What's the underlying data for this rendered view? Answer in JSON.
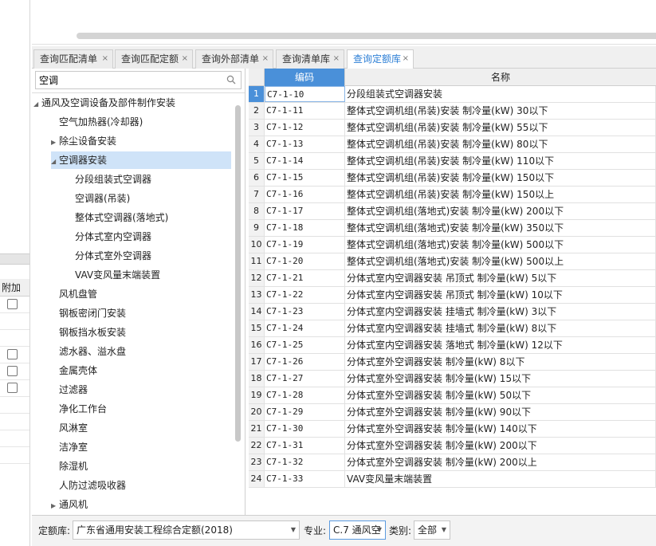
{
  "left_panel": {
    "header": "附加",
    "checkbox_rows": [
      true,
      false,
      false,
      true,
      true,
      true,
      false,
      false,
      false,
      false
    ]
  },
  "tabs": [
    {
      "label": "查询匹配清单",
      "close": "×"
    },
    {
      "label": "查询匹配定额",
      "close": "×"
    },
    {
      "label": "查询外部清单",
      "close": "×"
    },
    {
      "label": "查询清单库",
      "close": "×"
    },
    {
      "label": "查询定额库",
      "close": "×"
    }
  ],
  "search": {
    "value": "空调"
  },
  "tree": [
    {
      "label": "通风及空调设备及部件制作安装",
      "arrow": "◢",
      "level": 0
    },
    {
      "label": "空气加热器(冷却器)",
      "arrow": "",
      "level": 1
    },
    {
      "label": "除尘设备安装",
      "arrow": "▶",
      "level": 1
    },
    {
      "label": "空调器安装",
      "arrow": "◢",
      "level": 1
    },
    {
      "label": "分段组装式空调器",
      "arrow": "",
      "level": 2
    },
    {
      "label": "空调器(吊装)",
      "arrow": "",
      "level": 2
    },
    {
      "label": "整体式空调器(落地式)",
      "arrow": "",
      "level": 2
    },
    {
      "label": "分体式室内空调器",
      "arrow": "",
      "level": 2
    },
    {
      "label": "分体式室外空调器",
      "arrow": "",
      "level": 2
    },
    {
      "label": "VAV变风量末端装置",
      "arrow": "",
      "level": 2
    },
    {
      "label": "风机盘管",
      "arrow": "",
      "level": 1
    },
    {
      "label": "钢板密闭门安装",
      "arrow": "",
      "level": 1
    },
    {
      "label": "钢板挡水板安装",
      "arrow": "",
      "level": 1
    },
    {
      "label": "滤水器、溢水盘",
      "arrow": "",
      "level": 1
    },
    {
      "label": "金属壳体",
      "arrow": "",
      "level": 1
    },
    {
      "label": "过滤器",
      "arrow": "",
      "level": 1
    },
    {
      "label": "净化工作台",
      "arrow": "",
      "level": 1
    },
    {
      "label": "风淋室",
      "arrow": "",
      "level": 1
    },
    {
      "label": "洁净室",
      "arrow": "",
      "level": 1
    },
    {
      "label": "除湿机",
      "arrow": "",
      "level": 1
    },
    {
      "label": "人防过滤吸收器",
      "arrow": "",
      "level": 1
    },
    {
      "label": "通风机",
      "arrow": "▶",
      "level": 1
    }
  ],
  "grid": {
    "headers": {
      "code": "编码",
      "name": "名称"
    },
    "rows": [
      {
        "idx": "1",
        "code": "C7-1-10",
        "name": "分段组装式空调器安装"
      },
      {
        "idx": "2",
        "code": "C7-1-11",
        "name": "整体式空调机组(吊装)安装 制冷量(kW) 30以下"
      },
      {
        "idx": "3",
        "code": "C7-1-12",
        "name": "整体式空调机组(吊装)安装 制冷量(kW) 55以下"
      },
      {
        "idx": "4",
        "code": "C7-1-13",
        "name": "整体式空调机组(吊装)安装 制冷量(kW) 80以下"
      },
      {
        "idx": "5",
        "code": "C7-1-14",
        "name": "整体式空调机组(吊装)安装 制冷量(kW) 110以下"
      },
      {
        "idx": "6",
        "code": "C7-1-15",
        "name": "整体式空调机组(吊装)安装 制冷量(kW) 150以下"
      },
      {
        "idx": "7",
        "code": "C7-1-16",
        "name": "整体式空调机组(吊装)安装 制冷量(kW) 150以上"
      },
      {
        "idx": "8",
        "code": "C7-1-17",
        "name": "整体式空调机组(落地式)安装 制冷量(kW) 200以下"
      },
      {
        "idx": "9",
        "code": "C7-1-18",
        "name": "整体式空调机组(落地式)安装 制冷量(kW) 350以下"
      },
      {
        "idx": "10",
        "code": "C7-1-19",
        "name": "整体式空调机组(落地式)安装 制冷量(kW) 500以下"
      },
      {
        "idx": "11",
        "code": "C7-1-20",
        "name": "整体式空调机组(落地式)安装 制冷量(kW) 500以上"
      },
      {
        "idx": "12",
        "code": "C7-1-21",
        "name": "分体式室内空调器安装 吊顶式 制冷量(kW) 5以下"
      },
      {
        "idx": "13",
        "code": "C7-1-22",
        "name": "分体式室内空调器安装 吊顶式 制冷量(kW) 10以下"
      },
      {
        "idx": "14",
        "code": "C7-1-23",
        "name": "分体式室内空调器安装 挂墙式 制冷量(kW) 3以下"
      },
      {
        "idx": "15",
        "code": "C7-1-24",
        "name": "分体式室内空调器安装 挂墙式 制冷量(kW) 8以下"
      },
      {
        "idx": "16",
        "code": "C7-1-25",
        "name": "分体式室内空调器安装 落地式 制冷量(kW) 12以下"
      },
      {
        "idx": "17",
        "code": "C7-1-26",
        "name": "分体式室外空调器安装 制冷量(kW) 8以下"
      },
      {
        "idx": "18",
        "code": "C7-1-27",
        "name": "分体式室外空调器安装 制冷量(kW) 15以下"
      },
      {
        "idx": "19",
        "code": "C7-1-28",
        "name": "分体式室外空调器安装 制冷量(kW) 50以下"
      },
      {
        "idx": "20",
        "code": "C7-1-29",
        "name": "分体式室外空调器安装 制冷量(kW) 90以下"
      },
      {
        "idx": "21",
        "code": "C7-1-30",
        "name": "分体式室外空调器安装 制冷量(kW) 140以下"
      },
      {
        "idx": "22",
        "code": "C7-1-31",
        "name": "分体式室外空调器安装 制冷量(kW) 200以下"
      },
      {
        "idx": "23",
        "code": "C7-1-32",
        "name": "分体式室外空调器安装 制冷量(kW) 200以上"
      },
      {
        "idx": "24",
        "code": "C7-1-33",
        "name": "VAV变风量末端装置"
      }
    ]
  },
  "bottom": {
    "quota_label": "定额库:",
    "quota_value": "广东省通用安装工程综合定额(2018)",
    "major_label": "专业:",
    "major_value": "C.7 通风空",
    "category_label": "类别:",
    "category_value": "全部"
  },
  "colors": {
    "accent": "#4a90d9",
    "selected_tree": "#cfe3f8",
    "active_tab_text": "#2d7fd6"
  }
}
